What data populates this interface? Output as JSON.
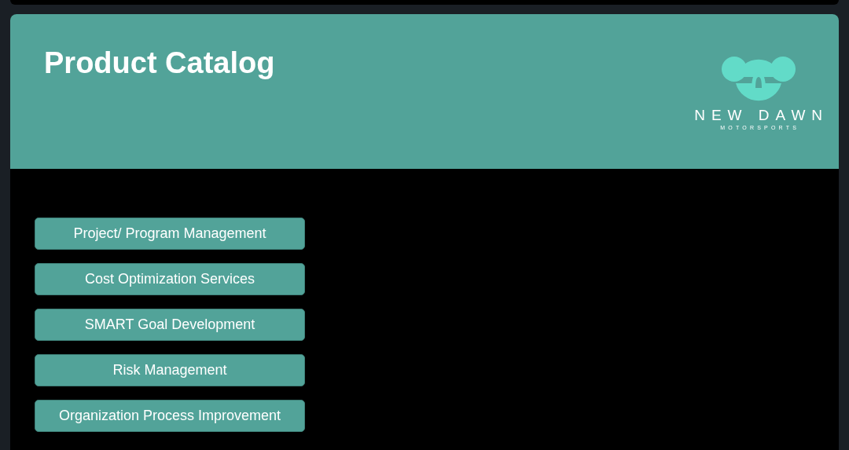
{
  "header": {
    "title": "Product Catalog",
    "logo": {
      "name": "NEW DAWN",
      "tagline": "MOTORSPORTS"
    }
  },
  "catalog_buttons": [
    {
      "label": "Project/ Program Management"
    },
    {
      "label": "Cost Optimization Services"
    },
    {
      "label": "SMART Goal Development"
    },
    {
      "label": "Risk Management"
    },
    {
      "label": "Organization Process Improvement"
    }
  ]
}
